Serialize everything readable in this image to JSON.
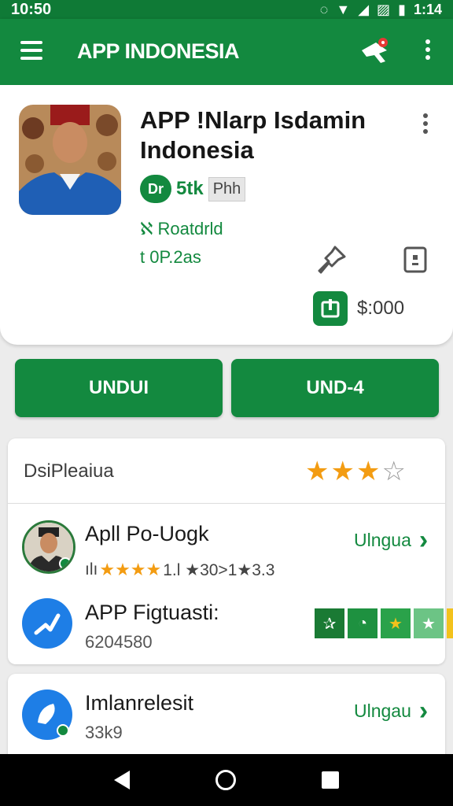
{
  "status_bar": {
    "time": "10:50",
    "time_right": "1:14"
  },
  "app_bar": {
    "title": "APP INDONESIA"
  },
  "top_card": {
    "title": "APP !Nlarp Isdamin Indonesia",
    "developer_badge": "Dr",
    "downloads": "5tk",
    "rating_chip": "Phh",
    "line1": "ℵ Roatdrld",
    "line2": "t 0P.2as",
    "price": "$:000"
  },
  "buttons": {
    "left_label": "UNDUI",
    "right_label": "UND-4"
  },
  "list": {
    "section_title": "DsiPleaiua",
    "section_rating": {
      "full": 3,
      "empty": 1
    },
    "item1": {
      "name": "Apll Po-Uogk",
      "link": "Ulngua",
      "meta": "1.l ★30>1★3.3",
      "meta_prefix": "ılı"
    },
    "item2": {
      "name": "APP Figtuasti:",
      "value": "6204580"
    }
  },
  "card2": {
    "name": "Imlanrelesit",
    "value": "33k9",
    "link": "Ulngau"
  },
  "colors": {
    "primary": "#13893f",
    "accent_star": "#f39c12",
    "blue": "#1e7ee6"
  }
}
